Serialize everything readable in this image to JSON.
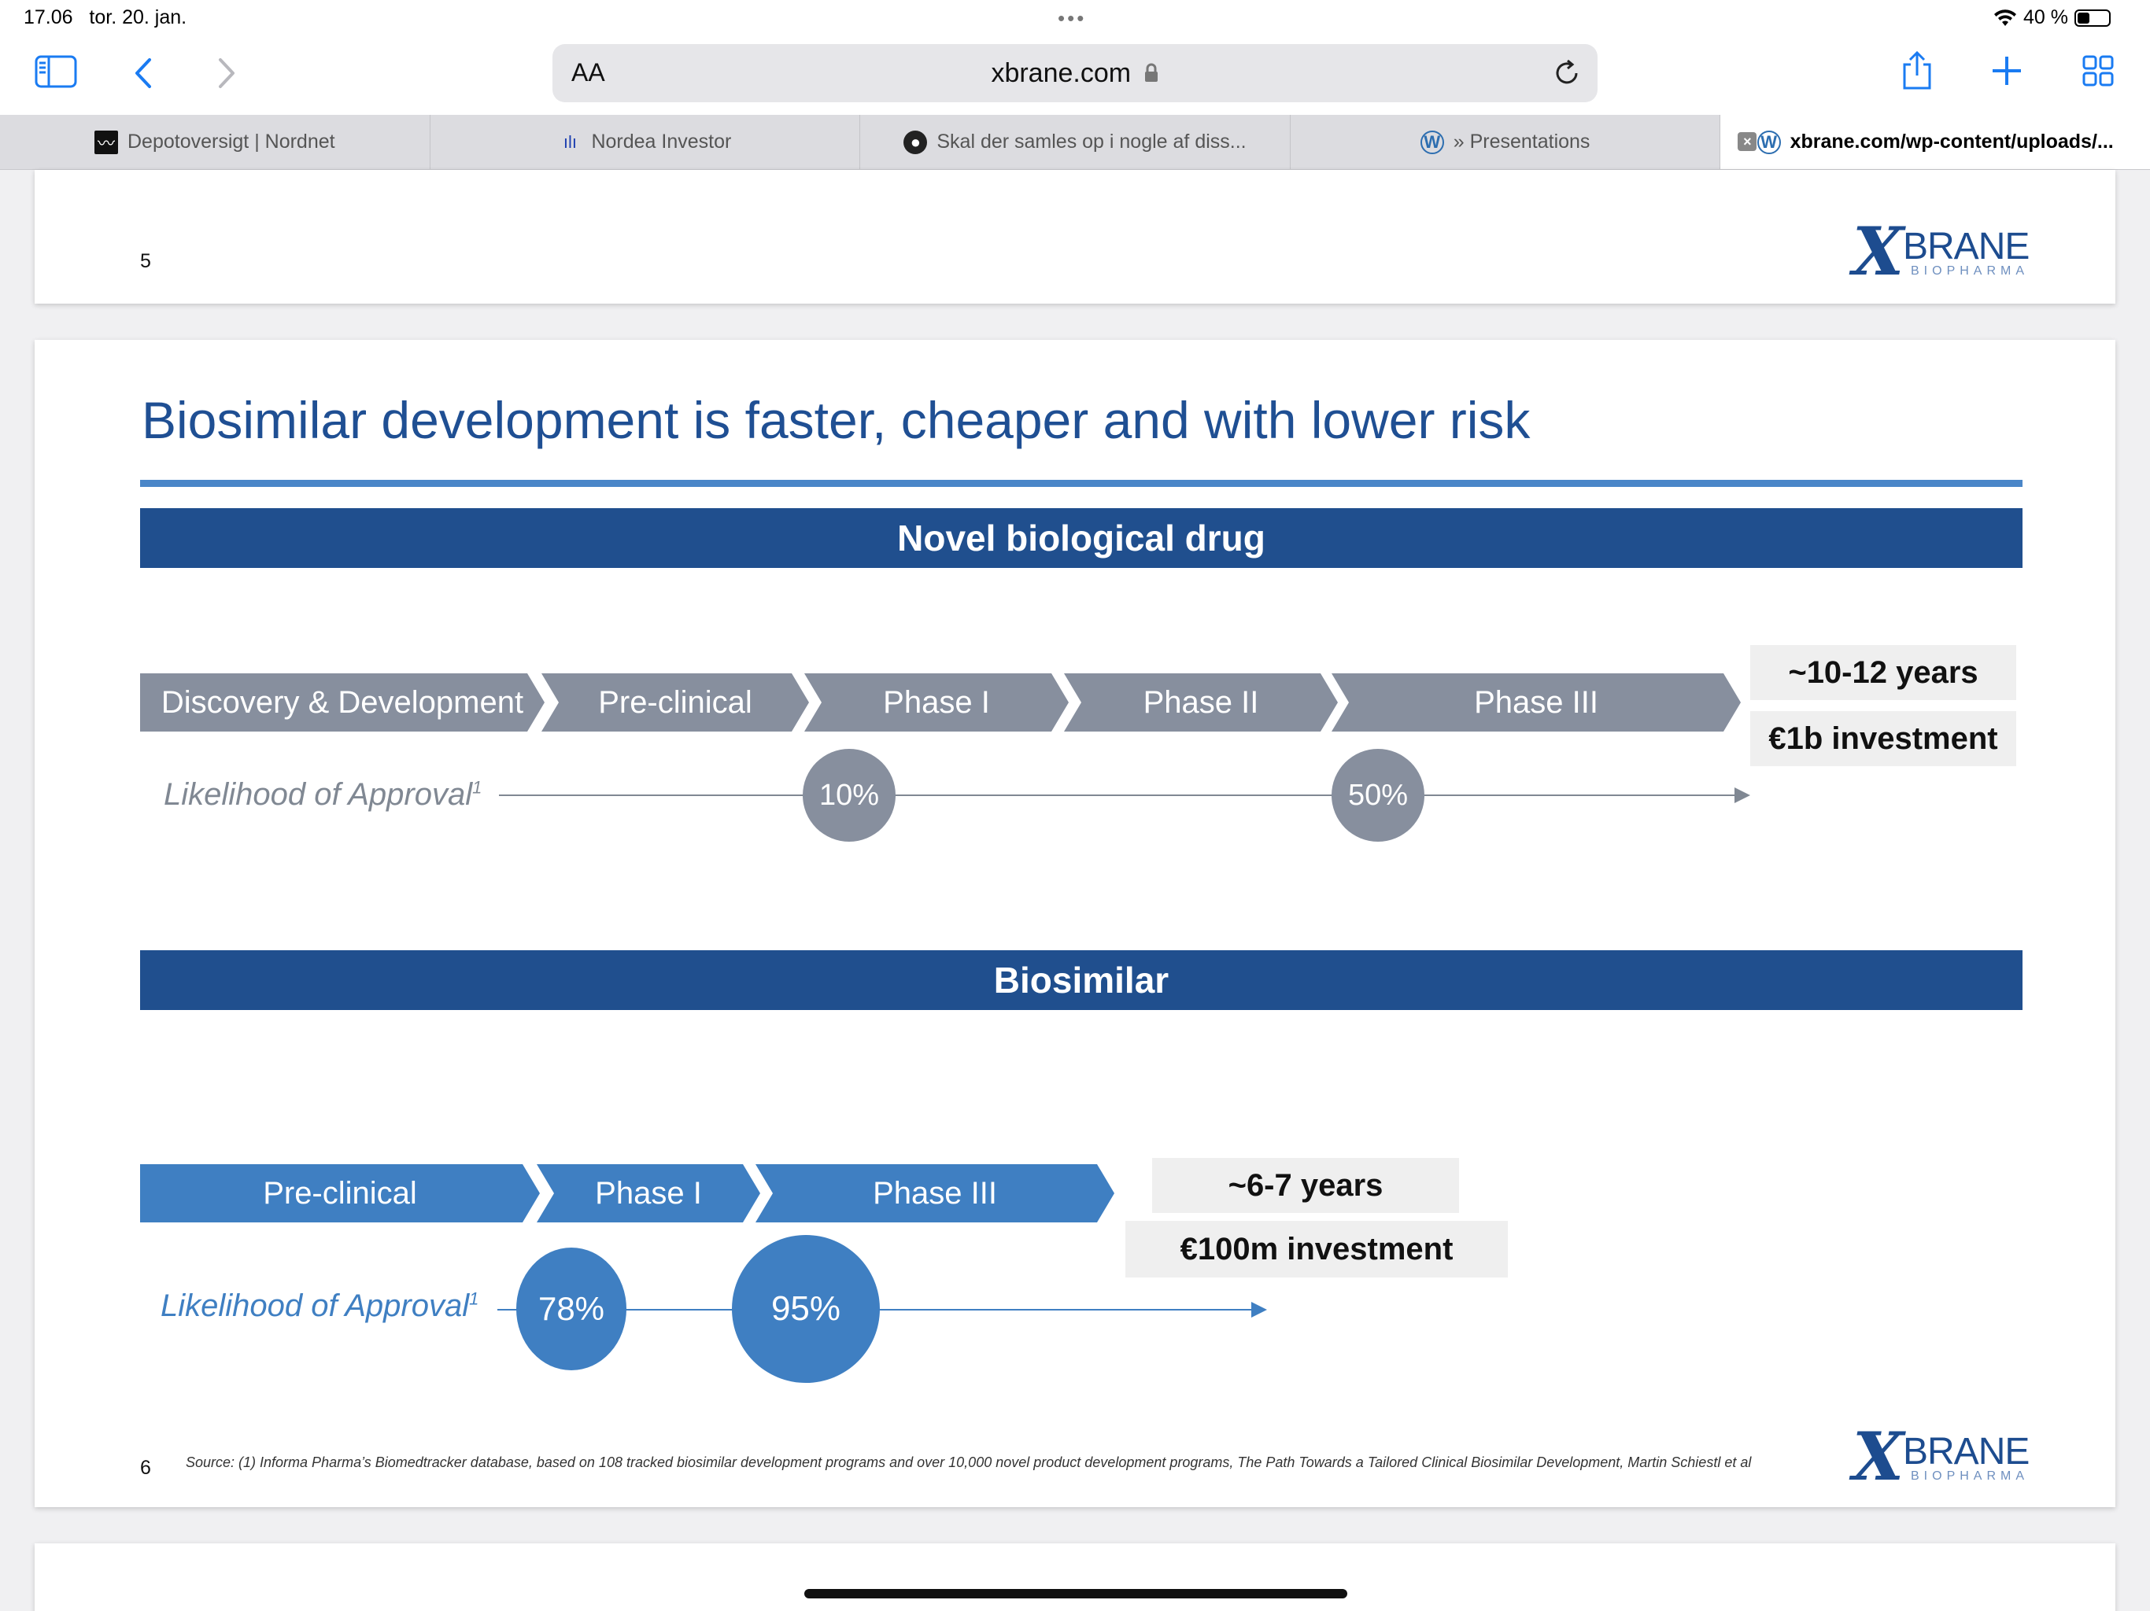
{
  "status": {
    "time": "17.06",
    "date": "tor. 20. jan.",
    "battery": "40 %",
    "battery_level": 0.4
  },
  "browser": {
    "url": "xbrane.com",
    "aa_label": "AA",
    "tabs": [
      {
        "title": "Depotoversigt | Nordnet",
        "active": false
      },
      {
        "title": "Nordea Investor",
        "active": false
      },
      {
        "title": "Skal der samles op i nogle af diss...",
        "active": false
      },
      {
        "title": "» Presentations",
        "active": false
      },
      {
        "title": "xbrane.com/wp-content/uploads/...",
        "active": true
      }
    ]
  },
  "logo": {
    "word": "BRANE",
    "sub": "BIOPHARMA"
  },
  "slide_prev": {
    "page": "5"
  },
  "slide": {
    "page": "6",
    "title": "Biosimilar development is faster, cheaper and with lower risk",
    "novel": {
      "banner": "Novel biological drug",
      "stages": [
        "Discovery & Development",
        "Pre-clinical",
        "Phase I",
        "Phase II",
        "Phase III"
      ],
      "years": "~10-12 years",
      "investment": "€1b investment",
      "loa_label": "Likelihood of Approval",
      "loa_sup": "1",
      "markers": [
        "10%",
        "50%"
      ]
    },
    "biosimilar": {
      "banner": "Biosimilar",
      "stages": [
        "Pre-clinical",
        "Phase I",
        "Phase III"
      ],
      "years": "~6-7 years",
      "investment": "€100m investment",
      "loa_label": "Likelihood of Approval",
      "loa_sup": "1",
      "markers": [
        "78%",
        "95%"
      ]
    },
    "source": "Source: (1) Informa Pharma’s Biomedtracker database, based on 108 tracked biosimilar development programs and over 10,000 novel product development programs, The Path Towards a Tailored Clinical Biosimilar Development, Martin Schiestl et al"
  },
  "colors": {
    "title_blue": "#1f4f93",
    "banner_blue": "#204f8e",
    "chevron_gray": "#878f9e",
    "chevron_blue": "#3f7fc2",
    "ios_blue": "#1a7bf2"
  }
}
